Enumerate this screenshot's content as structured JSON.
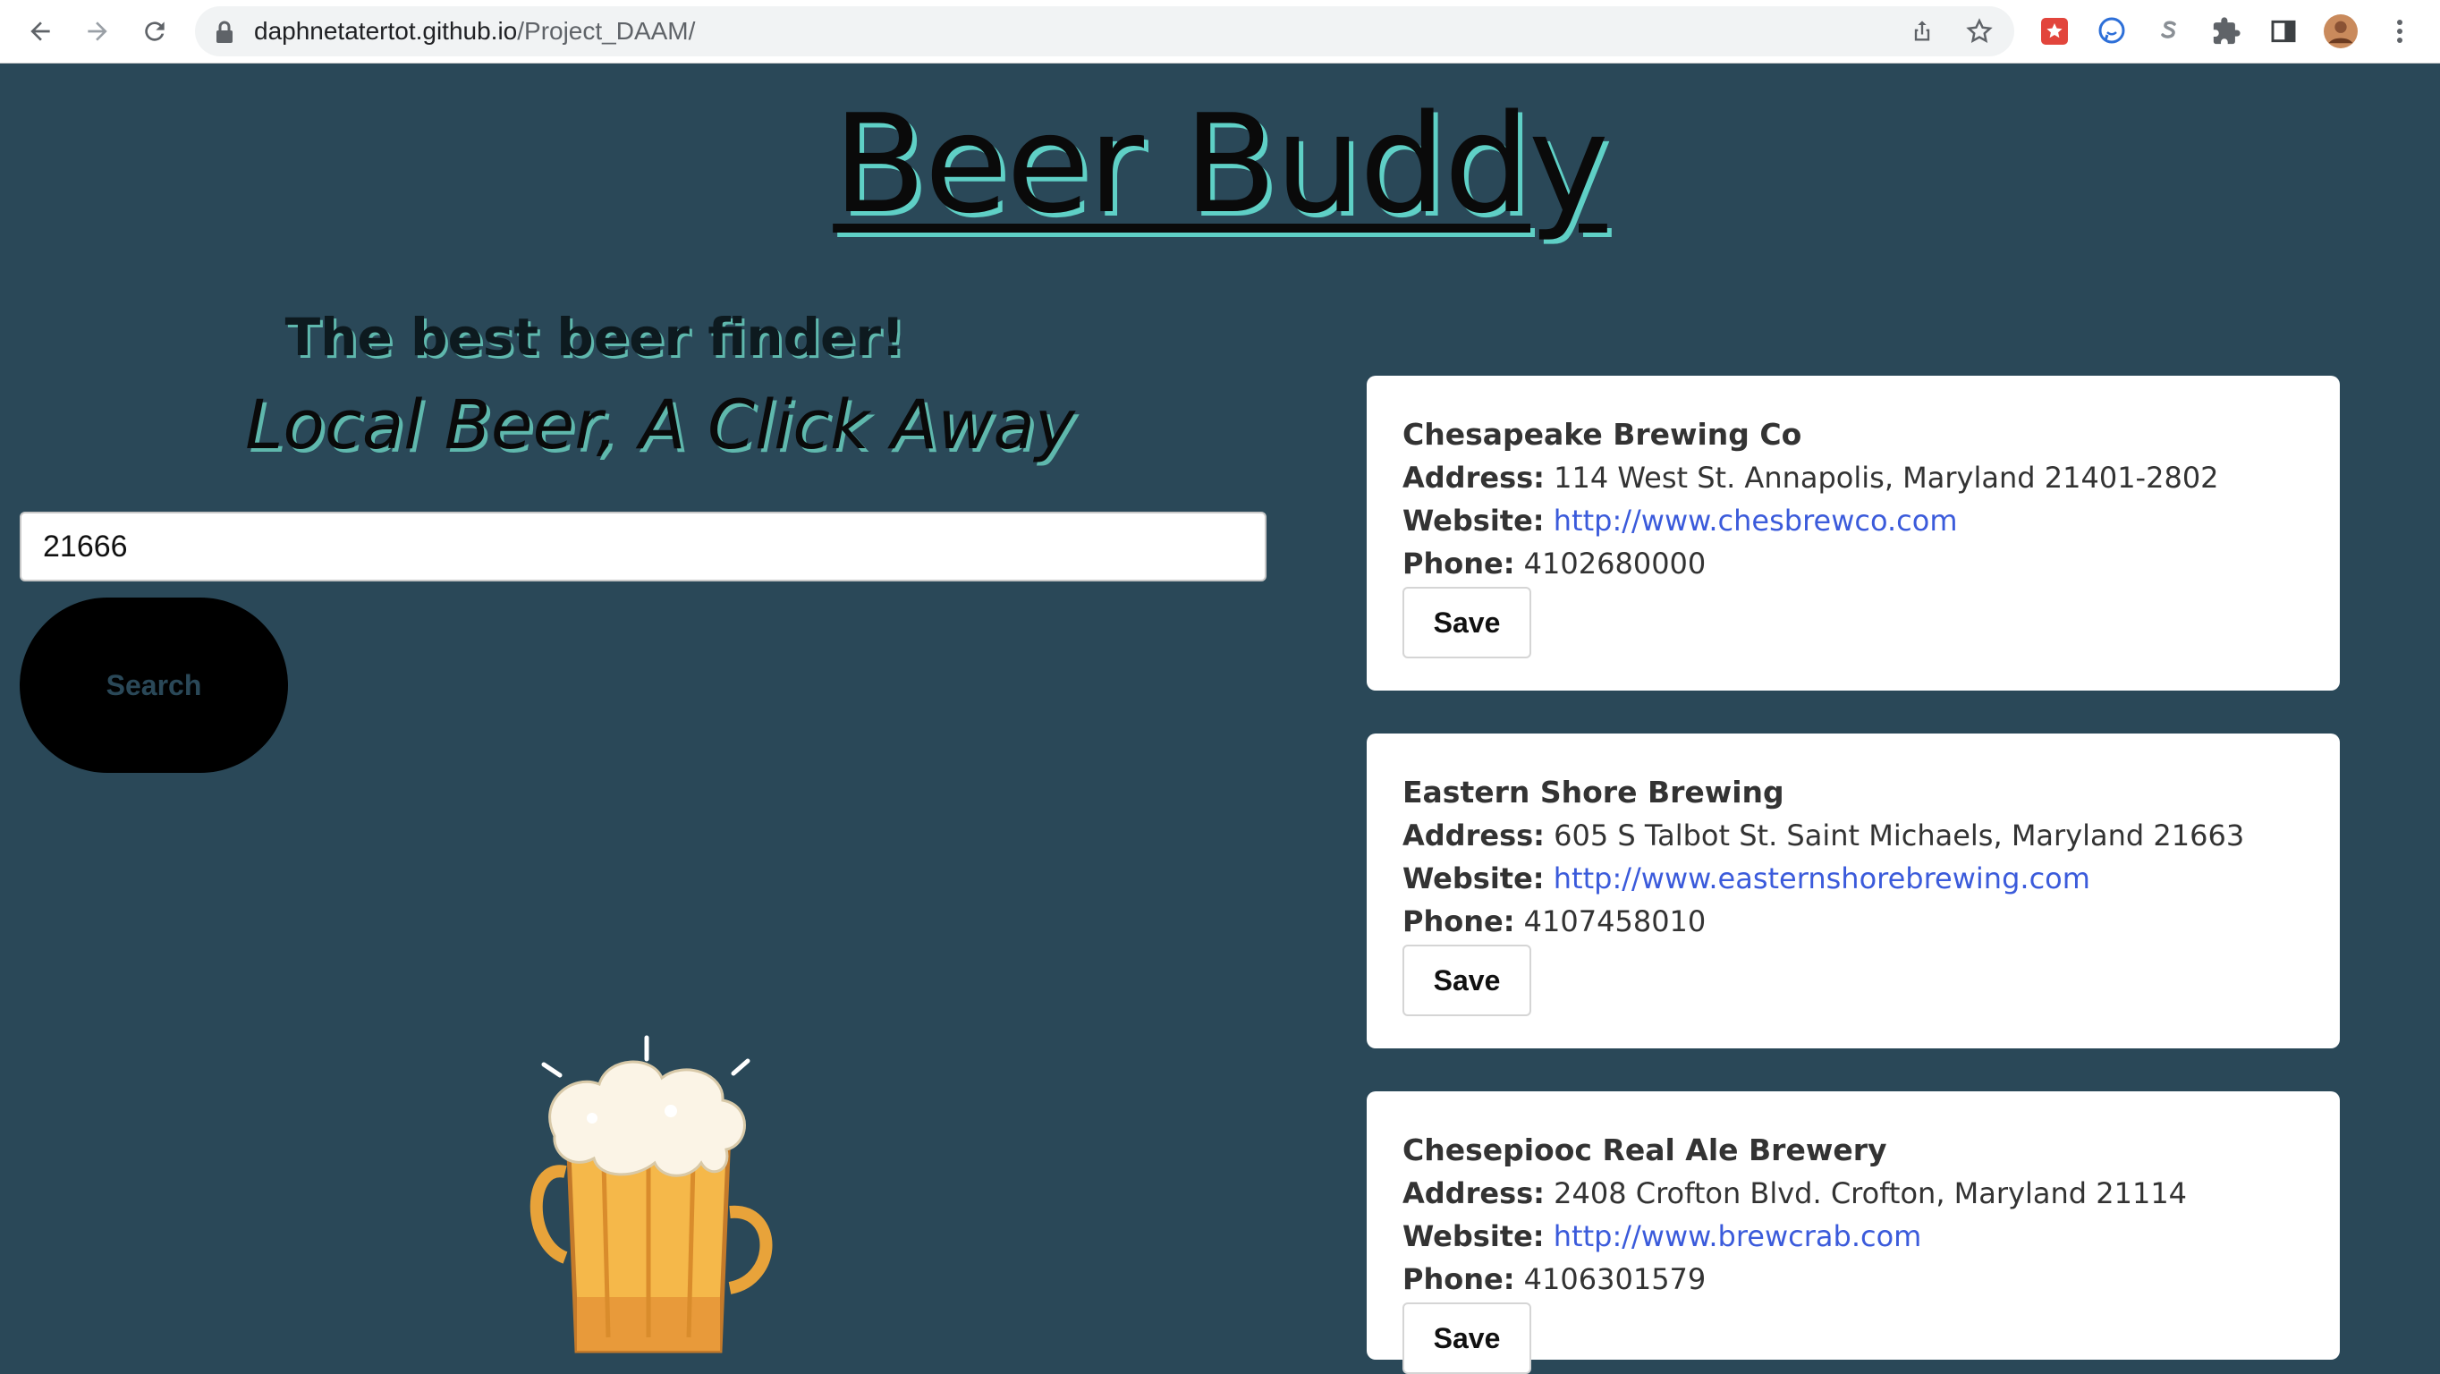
{
  "browser": {
    "url_host": "daphnetatertot.github.io",
    "url_path": "/Project_DAAM/"
  },
  "page": {
    "title": "Beer Buddy",
    "tagline": "The best beer finder!",
    "subtagline": "Local Beer, A Click Away",
    "search": {
      "value": "21666",
      "button_label": "Search"
    }
  },
  "labels": {
    "address": "Address:",
    "website": "Website:",
    "phone": "Phone:",
    "save": "Save"
  },
  "results": [
    {
      "name": "Chesapeake Brewing Co",
      "address": "114 West St. Annapolis, Maryland 21401-2802",
      "website": "http://www.chesbrewco.com",
      "phone": "4102680000"
    },
    {
      "name": "Eastern Shore Brewing",
      "address": "605 S Talbot St. Saint Michaels, Maryland 21663",
      "website": "http://www.easternshorebrewing.com",
      "phone": "4107458010"
    },
    {
      "name": "Chesepiooc Real Ale Brewery",
      "address": "2408 Crofton Blvd. Crofton, Maryland 21114",
      "website": "http://www.brewcrab.com",
      "phone": "4106301579"
    }
  ],
  "colors": {
    "background": "#2a4858",
    "title_shadow": "#5fd0c6",
    "link": "#3b5bdb"
  }
}
